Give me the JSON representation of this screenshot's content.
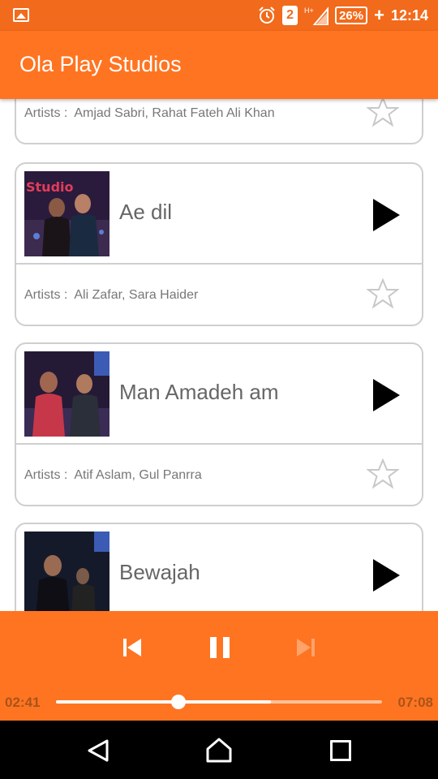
{
  "status_bar": {
    "sim_slot": "2",
    "battery": "26%",
    "time": "12:14"
  },
  "app": {
    "title": "Ola Play Studios"
  },
  "songs": [
    {
      "title": "",
      "artists_label": "Artists :",
      "artists": "Amjad Sabri,  Rahat Fateh Ali Khan",
      "favorite": false
    },
    {
      "title": "Ae dil",
      "artists_label": "Artists :",
      "artists": "Ali Zafar, Sara Haider",
      "favorite": false
    },
    {
      "title": "Man Amadeh am",
      "artists_label": "Artists :",
      "artists": "Atif Aslam, Gul Panrra",
      "favorite": false
    },
    {
      "title": "Bewajah",
      "artists_label": "Artists :",
      "artists": "",
      "favorite": false
    }
  ],
  "player": {
    "current_time": "02:41",
    "total_time": "07:08",
    "progress": 0.375,
    "buffered": 0.66,
    "controls": [
      "skip-previous-icon",
      "pause-icon",
      "skip-next-icon"
    ]
  },
  "colors": {
    "status_bar": "#f26a1b",
    "accent": "#ff7421",
    "card_border": "#cfcfcf",
    "text": "#666666"
  }
}
